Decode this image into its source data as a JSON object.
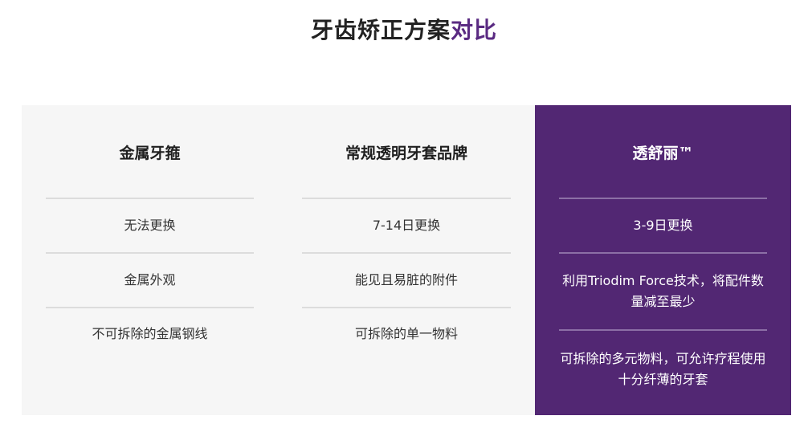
{
  "heading": {
    "main": "牙齿矫正方案",
    "accent": "对比"
  },
  "columns": {
    "metal": {
      "title": "金属牙箍",
      "rows": [
        "无法更换",
        "金属外观",
        "不可拆除的金属钢线"
      ]
    },
    "regular": {
      "title": "常规透明牙套品牌",
      "rows": [
        "7-14日更换",
        "能见且易脏的附件",
        "可拆除的单一物料"
      ]
    },
    "invisalign": {
      "title": "透舒丽™",
      "rows": [
        "3-9日更换",
        "利用Triodim Force技术，将配件数量减至最少",
        "可拆除的多元物料，可允许疗程使用十分纤薄的牙套"
      ]
    }
  },
  "colors": {
    "accent": "#522773",
    "background": "#f6f6f6"
  }
}
